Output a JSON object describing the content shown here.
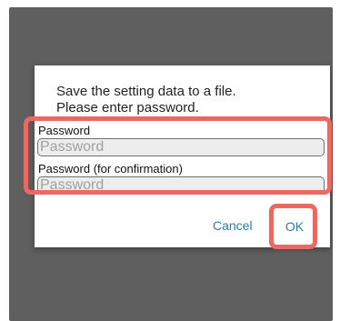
{
  "dialog": {
    "message_line1": "Save the setting data to a file.",
    "message_line2": "Please enter password.",
    "password_label": "Password",
    "password_placeholder": "Password",
    "confirm_label": "Password (for confirmation)",
    "confirm_placeholder": "Password",
    "cancel_label": "Cancel",
    "ok_label": "OK"
  },
  "colors": {
    "overlay": "#5f5f5f",
    "accent": "#2a7fa6",
    "highlight": "#e86a63"
  }
}
